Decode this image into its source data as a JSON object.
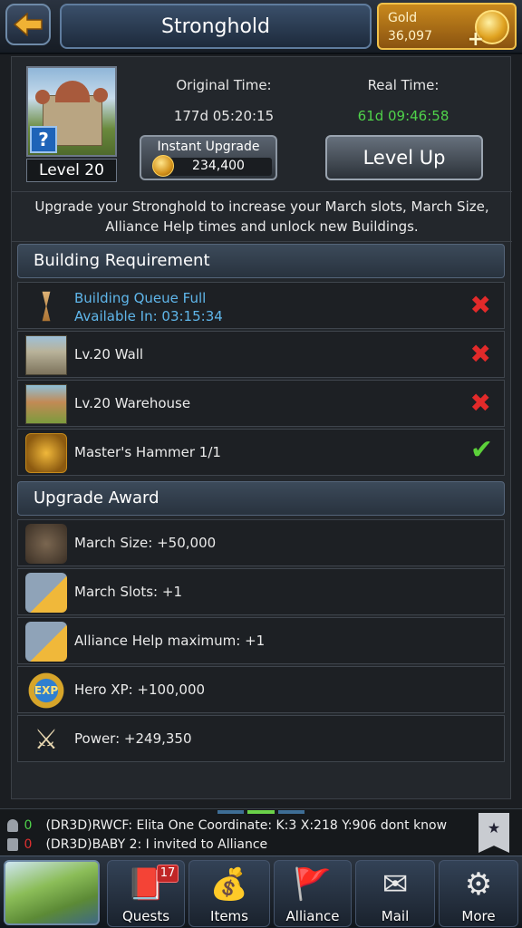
{
  "header": {
    "title": "Stronghold",
    "gold_label": "Gold",
    "gold_value": "36,097",
    "gold_plus": "+"
  },
  "building": {
    "level_label": "Level 20",
    "help_icon": "?",
    "original_time_label": "Original Time:",
    "original_time_value": "177d 05:20:15",
    "real_time_label": "Real Time:",
    "real_time_value": "61d 09:46:58",
    "instant_upgrade_label": "Instant Upgrade",
    "instant_upgrade_cost": "234,400",
    "level_up_label": "Level Up",
    "description": "Upgrade your Stronghold to increase your March slots, March Size, Alliance Help times and unlock new Buildings."
  },
  "requirements": {
    "title": "Building Requirement",
    "items": [
      {
        "line1": "Building Queue Full",
        "line2": "Available In: 03:15:34",
        "icon": "hourglass-icon",
        "met": false
      },
      {
        "label": "Lv.20 Wall",
        "icon": "wall-icon",
        "met": false
      },
      {
        "label": "Lv.20 Warehouse",
        "icon": "warehouse-icon",
        "met": false
      },
      {
        "label": "Master's Hammer 1/1",
        "icon": "hammer-icon",
        "met": true
      }
    ]
  },
  "awards": {
    "title": "Upgrade Award",
    "items": [
      {
        "label": "March Size: +50,000",
        "icon": "march-size-icon"
      },
      {
        "label": "March Slots: +1",
        "icon": "march-slot-icon"
      },
      {
        "label": "Alliance Help maximum: +1",
        "icon": "alliance-help-icon"
      },
      {
        "label": "Hero XP: +100,000",
        "icon": "exp-icon",
        "badge": "EXP"
      },
      {
        "label": "Power: +249,350",
        "icon": "power-icon"
      }
    ]
  },
  "chat": {
    "lines": [
      {
        "count": "0",
        "count_color": "#4fd24a",
        "text": "(DR3D)RWCF: Elita One Coordinate: K:3 X:218 Y:906 dont know"
      },
      {
        "count": "0",
        "count_color": "#e03030",
        "text": "(DR3D)BABY 2: I invited to Alliance"
      }
    ]
  },
  "nav": {
    "items": [
      {
        "label": "Quests",
        "badge": "17"
      },
      {
        "label": "Items"
      },
      {
        "label": "Alliance"
      },
      {
        "label": "Mail"
      },
      {
        "label": "More"
      }
    ]
  },
  "colors": {
    "real_time": "#4fd24a",
    "requirement_unmet": "#e22a2a",
    "requirement_met": "#5cd13a",
    "queue_text": "#5fb6ea",
    "gold_accent": "#c9891d"
  }
}
